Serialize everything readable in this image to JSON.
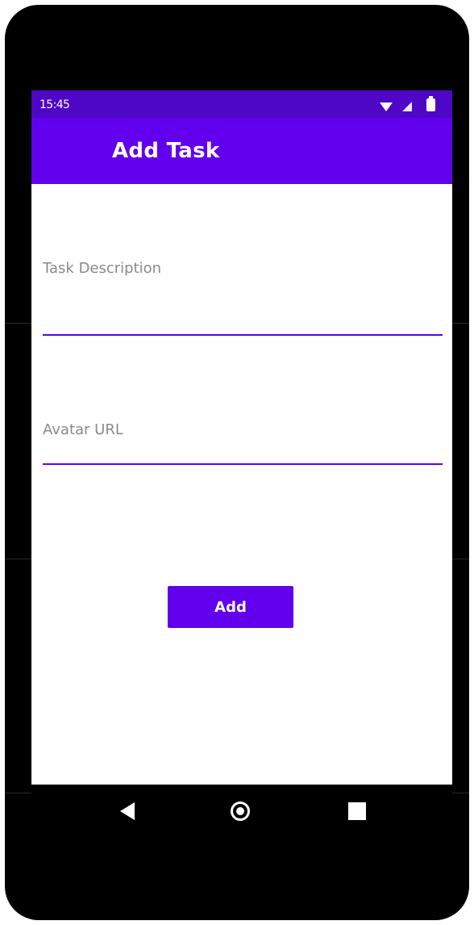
{
  "status_bar": {
    "time": "15:45",
    "icons": [
      "wifi-icon",
      "cell-signal-icon",
      "battery-icon"
    ]
  },
  "app_bar": {
    "title": "Add Task"
  },
  "form": {
    "task_description": {
      "placeholder": "Task Description",
      "value": ""
    },
    "avatar_url": {
      "placeholder": "Avatar URL",
      "value": ""
    },
    "add_label": "Add"
  },
  "nav_bar": {
    "buttons": [
      "back-icon",
      "home-icon",
      "recents-icon"
    ]
  },
  "colors": {
    "primary": "#6200ee",
    "primary_dark": "#4e06c7",
    "hint_text": "#8a8a8a",
    "background": "#ffffff"
  }
}
